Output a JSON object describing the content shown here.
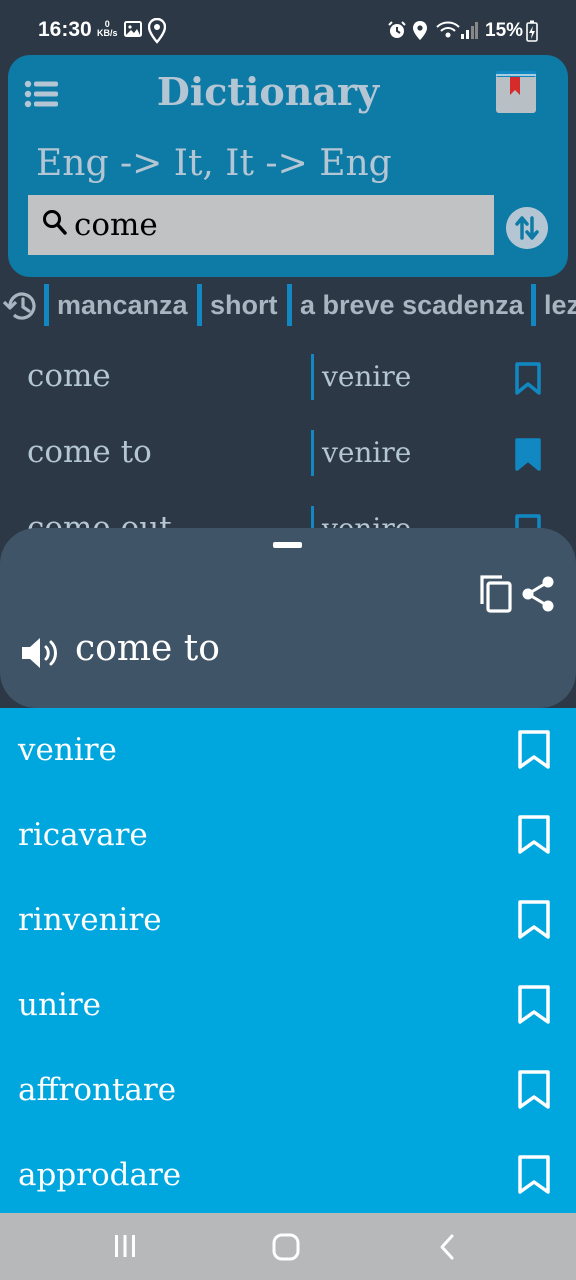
{
  "status_bar": {
    "time": "16:30",
    "data_speed_value": "0",
    "data_speed_unit": "KB/s",
    "battery": "15%"
  },
  "header": {
    "title": "Dictionary",
    "direction": "Eng -> It,  It -> Eng",
    "search_value": "come",
    "background_color": "#0e7aa6"
  },
  "history": [
    "mancanza",
    "short",
    "a breve scadenza",
    "lez"
  ],
  "results": [
    {
      "word": "come",
      "translation": "venire",
      "bookmarked": false
    },
    {
      "word": "come to",
      "translation": "venire",
      "bookmarked": true
    },
    {
      "word": "come out",
      "translation": "venire",
      "bookmarked": false
    }
  ],
  "detail_sheet": {
    "word": "come to",
    "icons": [
      "copy-icon",
      "share-icon",
      "speaker-icon"
    ]
  },
  "translations": [
    {
      "word": "venire"
    },
    {
      "word": "ricavare"
    },
    {
      "word": "rinvenire"
    },
    {
      "word": "unire"
    },
    {
      "word": "affrontare"
    },
    {
      "word": "approdare"
    }
  ],
  "colors": {
    "accent": "#1288c2",
    "translation_panel": "#00a6de",
    "sheet": "#3f5467",
    "background": "#2c3845"
  }
}
